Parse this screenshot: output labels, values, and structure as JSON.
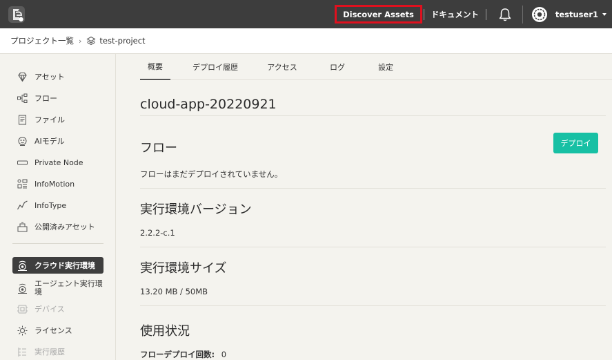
{
  "topbar": {
    "discover_assets": "Discover Assets",
    "documents": "ドキュメント",
    "username": "testuser1"
  },
  "breadcrumb": {
    "project_list": "プロジェクト一覧",
    "separator": "›",
    "project": "test-project"
  },
  "sidebar": {
    "items": [
      {
        "label": "アセット",
        "icon": "diamond-icon"
      },
      {
        "label": "フロー",
        "icon": "flow-icon"
      },
      {
        "label": "ファイル",
        "icon": "file-icon"
      },
      {
        "label": "AIモデル",
        "icon": "ai-model-icon"
      },
      {
        "label": "Private Node",
        "icon": "private-node-icon"
      },
      {
        "label": "InfoMotion",
        "icon": "infomotion-icon"
      },
      {
        "label": "InfoType",
        "icon": "infotype-icon"
      },
      {
        "label": "公開済みアセット",
        "icon": "published-asset-icon"
      },
      {
        "label": "クラウド実行環境",
        "icon": "cloud-runtime-icon",
        "active": true
      },
      {
        "label": "エージェント実行環境",
        "icon": "agent-runtime-icon"
      },
      {
        "label": "デバイス",
        "icon": "device-icon",
        "disabled": true
      },
      {
        "label": "ライセンス",
        "icon": "license-icon"
      },
      {
        "label": "実行履歴",
        "icon": "history-icon",
        "disabled": true
      }
    ]
  },
  "tabs": [
    "概要",
    "デプロイ履歴",
    "アクセス",
    "ログ",
    "設定"
  ],
  "main": {
    "app_name": "cloud-app-20220921",
    "flow_heading": "フロー",
    "deploy_button": "デプロイ",
    "flow_status": "フローはまだデプロイされていません。",
    "runtime_version_heading": "実行環境バージョン",
    "runtime_version": "2.2.2-c.1",
    "runtime_size_heading": "実行環境サイズ",
    "runtime_size": "13.20 MB / 50MB",
    "usage_heading": "使用状況",
    "deploy_count_label": "フローデプロイ回数:",
    "deploy_count_value": "0"
  },
  "colors": {
    "topbar": "#3d3d3d",
    "highlight": "#e0101e",
    "accent": "#17c0a4",
    "active_nav": "#3e3e3e"
  }
}
